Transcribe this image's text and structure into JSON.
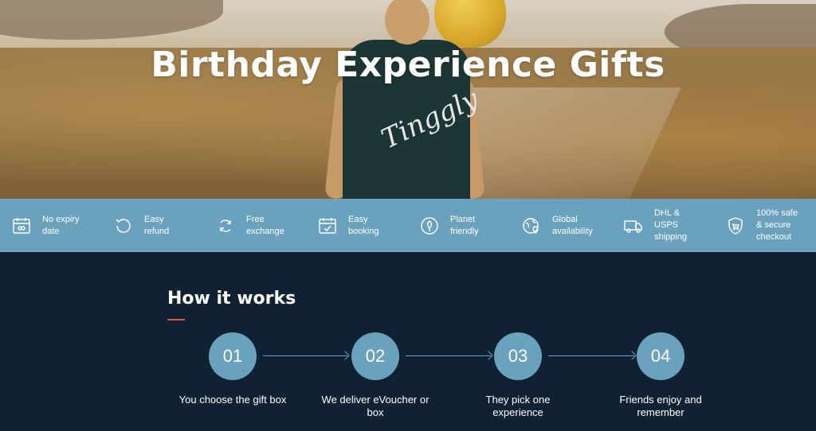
{
  "hero": {
    "title": "Birthday Experience Gifts",
    "shirt_text": "Tinggly"
  },
  "features": [
    {
      "icon": "calendar-infinity-icon",
      "label": "No expiry\ndate"
    },
    {
      "icon": "refresh-icon",
      "label": "Easy\nrefund"
    },
    {
      "icon": "exchange-arrows-icon",
      "label": "Free\nexchange"
    },
    {
      "icon": "calendar-check-icon",
      "label": "Easy\nbooking"
    },
    {
      "icon": "planet-leaf-icon",
      "label": "Planet\nfriendly"
    },
    {
      "icon": "globe-pin-icon",
      "label": "Global\navailability"
    },
    {
      "icon": "delivery-truck-icon",
      "label": "DHL &\nUSPS\nshipping"
    },
    {
      "icon": "shield-cart-icon",
      "label": "100% safe\n& secure\ncheckout"
    }
  ],
  "how": {
    "title": "How it works",
    "steps": [
      {
        "number": "01",
        "caption": "You choose the gift box"
      },
      {
        "number": "02",
        "caption": "We deliver eVoucher or box"
      },
      {
        "number": "03",
        "caption": "They pick one experience"
      },
      {
        "number": "04",
        "caption": "Friends enjoy and remember"
      }
    ]
  },
  "colors": {
    "accent": "#6aa2bd",
    "dark_bg": "#0f2132",
    "underline": "#d4584a"
  }
}
